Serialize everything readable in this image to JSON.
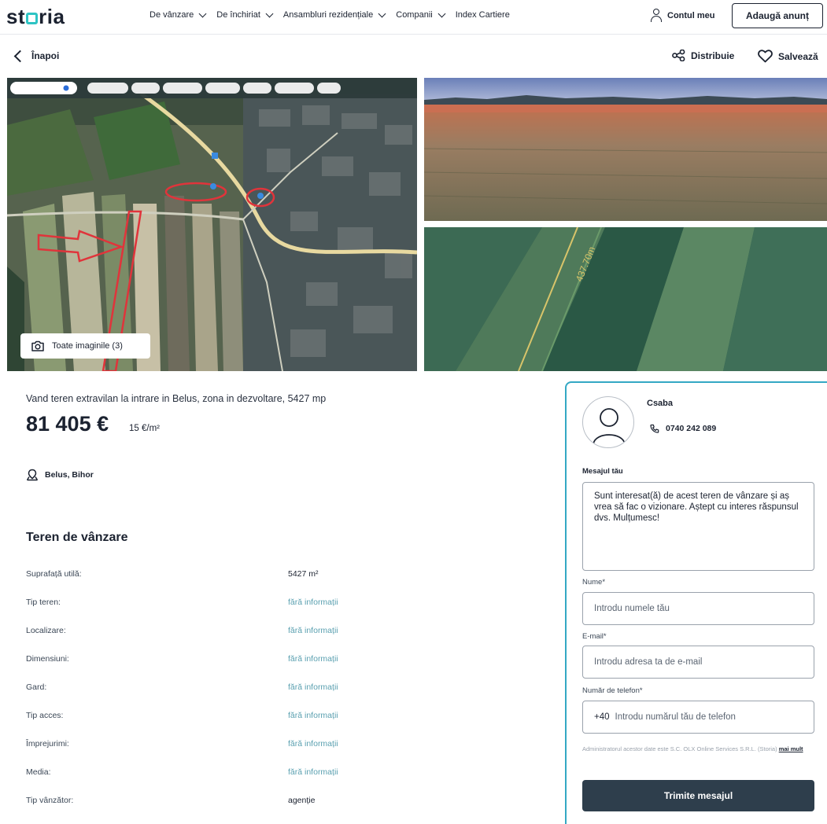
{
  "header": {
    "logo": {
      "pre": "st",
      "post": "ria"
    },
    "nav": [
      {
        "label": "De vânzare"
      },
      {
        "label": "De închiriat"
      },
      {
        "label": "Ansambluri rezidențiale"
      },
      {
        "label": "Companii"
      },
      {
        "label": "Index Cartiere"
      }
    ],
    "account_label": "Contul meu",
    "add_ad_label": "Adaugă anunț"
  },
  "toolbar": {
    "back_label": "Înapoi",
    "share_label": "Distribuie",
    "save_label": "Salvează"
  },
  "gallery": {
    "all_images_label": "Toate imaginile (3)",
    "map_measure_label": "437.70m"
  },
  "listing": {
    "title": "Vand teren extravilan la intrare in Belus, zona in dezvoltare, 5427 mp",
    "price": "81 405 €",
    "price_per_sqm": "15 €/m²",
    "location": "Belus, Bihor",
    "section_title": "Teren de vânzare",
    "details": [
      {
        "label": "Suprafață utilă:",
        "value": "5427 m²",
        "missing": false
      },
      {
        "label": "Tip teren:",
        "value": "fără informații",
        "missing": true
      },
      {
        "label": "Localizare:",
        "value": "fără informații",
        "missing": true
      },
      {
        "label": "Dimensiuni:",
        "value": "fără informații",
        "missing": true
      },
      {
        "label": "Gard:",
        "value": "fără informații",
        "missing": true
      },
      {
        "label": "Tip acces:",
        "value": "fără informații",
        "missing": true
      },
      {
        "label": "Împrejurimi:",
        "value": "fără informații",
        "missing": true
      },
      {
        "label": "Media:",
        "value": "fără informații",
        "missing": true
      },
      {
        "label": "Tip vânzător:",
        "value": "agenție",
        "missing": false
      }
    ]
  },
  "contact": {
    "name": "Csaba",
    "phone": "0740 242 089",
    "message_label": "Mesajul tău",
    "message_text": "Sunt interesat(ă) de acest teren de vânzare și aș vrea să fac o vizionare. Aștept cu interes răspunsul dvs. Mulțumesc!",
    "name_label": "Nume*",
    "name_placeholder": "Introdu numele tău",
    "email_label": "E-mail*",
    "email_placeholder": "Introdu adresa ta de e-mail",
    "phone_label": "Număr de telefon*",
    "phone_prefix": "+40",
    "phone_placeholder": "Introdu numărul tău de telefon",
    "disclaimer": "Administratorul acestor date este S.C. OLX Online Services S.R.L. (Storia)",
    "disclaimer_more": "mai mult",
    "send_label": "Trimite mesajul"
  },
  "colors": {
    "brand_accent": "#2ec4c4",
    "card_border": "#34a8c4",
    "send_button": "#2e3e4c",
    "missing_value": "#5aa0b0"
  }
}
